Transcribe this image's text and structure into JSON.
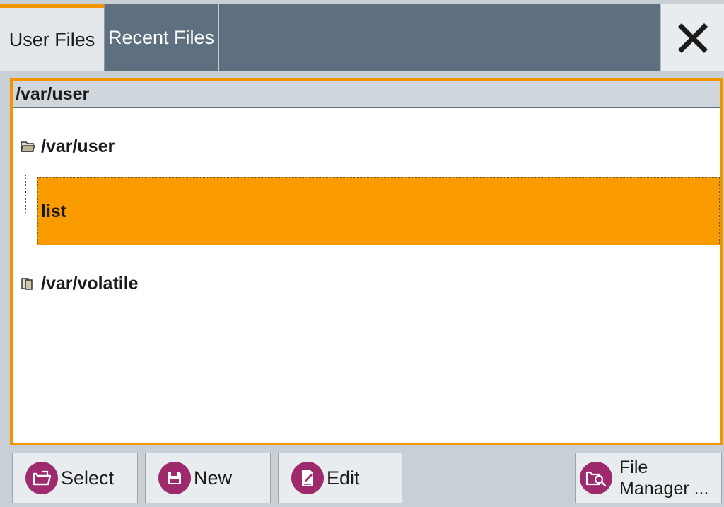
{
  "tabs": {
    "user_files": "User Files",
    "recent_files": "Recent Files"
  },
  "close_icon": "close-icon",
  "path_header": "/var/user",
  "tree": {
    "root_user": "/var/user",
    "selected_item": "list",
    "root_volatile": "/var/volatile"
  },
  "buttons": {
    "select": "Select",
    "new": "New",
    "edit": "Edit",
    "file_manager_line1": "File",
    "file_manager_line2": "Manager ..."
  },
  "colors": {
    "accent": "#f29400",
    "selection": "#fa9c00",
    "tab_bar": "#5e7080",
    "button_icon": "#9c2a6c"
  }
}
